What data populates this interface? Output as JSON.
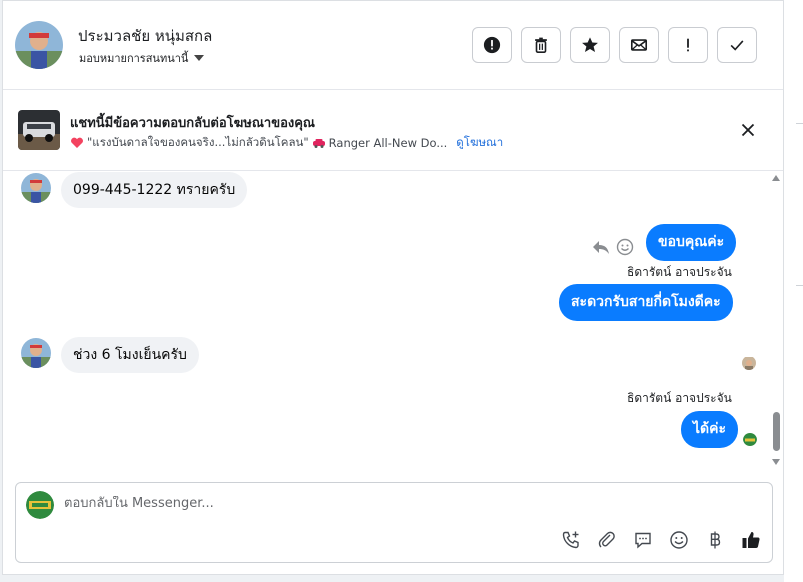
{
  "contact": {
    "name": "ประมวลชัย หนุ่มสกล",
    "assign_label": "มอบหมายการสนทนานี้"
  },
  "actions": [
    {
      "icon": "alert-circle-icon",
      "label": "!"
    },
    {
      "icon": "trash-icon",
      "label": ""
    },
    {
      "icon": "star-icon",
      "label": ""
    },
    {
      "icon": "envelope-icon",
      "label": ""
    },
    {
      "icon": "exclamation-icon",
      "label": "!"
    },
    {
      "icon": "checkmark-icon",
      "label": ""
    }
  ],
  "ad_banner": {
    "title": "แชทนี้มีข้อความตอบกลับต่อโฆษณาของคุณ",
    "subtitle": "\"แรงบันดาลใจของคนจริง...ไม่กลัวดินโคลน\"",
    "subtitle_tail": "Ranger All-New Do...",
    "link": "ดูโฆษณา"
  },
  "messages": [
    {
      "side": "in",
      "text": "099-445-1222 ทรายครับ"
    },
    {
      "side": "out",
      "text": "ขอบคุณค่ะ"
    },
    {
      "side": "sender",
      "text": "ธิดารัตน์ อาจประจัน"
    },
    {
      "side": "out",
      "text": "สะดวกรับสายกี่ดโมงดีคะ"
    },
    {
      "side": "in",
      "text": "ช่วง 6 โมงเย็นครับ"
    },
    {
      "side": "sender",
      "text": "ธิดารัตน์ อาจประจัน"
    },
    {
      "side": "out",
      "text": "ได้ค่ะ"
    }
  ],
  "composer": {
    "placeholder": "ตอบกลับใน Messenger..."
  },
  "colors": {
    "outgoing_bubble": "#0a7cff",
    "incoming_bubble": "#f0f2f5",
    "link": "#216fdb"
  }
}
